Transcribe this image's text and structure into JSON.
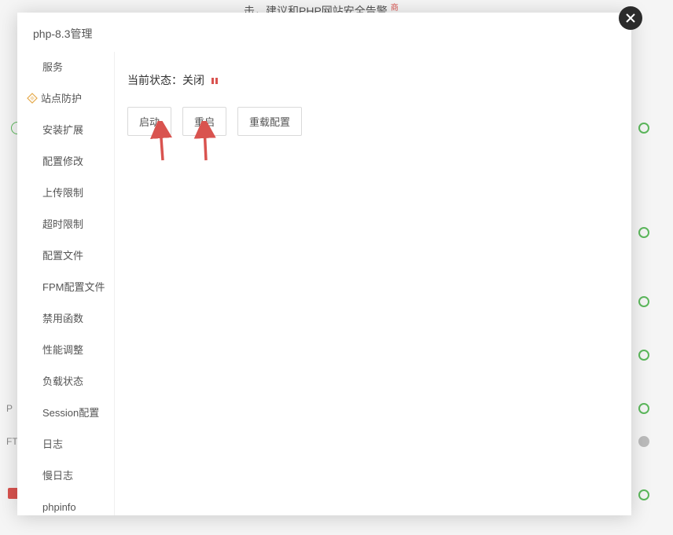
{
  "background": {
    "topText": "击，建议和PHP网站安全告警",
    "redTag": "商"
  },
  "modal": {
    "title": "php-8.3管理",
    "sidebar": {
      "items": [
        {
          "label": "服务",
          "key": "service"
        },
        {
          "label": "站点防护",
          "key": "siteprotect",
          "icon": true
        },
        {
          "label": "安装扩展",
          "key": "install-ext"
        },
        {
          "label": "配置修改",
          "key": "config-edit"
        },
        {
          "label": "上传限制",
          "key": "upload-limit"
        },
        {
          "label": "超时限制",
          "key": "timeout-limit"
        },
        {
          "label": "配置文件",
          "key": "config-file"
        },
        {
          "label": "FPM配置文件",
          "key": "fpm-config"
        },
        {
          "label": "禁用函数",
          "key": "disabled-funcs"
        },
        {
          "label": "性能调整",
          "key": "performance"
        },
        {
          "label": "负载状态",
          "key": "load-status"
        },
        {
          "label": "Session配置",
          "key": "session-config"
        },
        {
          "label": "日志",
          "key": "log"
        },
        {
          "label": "慢日志",
          "key": "slow-log"
        },
        {
          "label": "phpinfo",
          "key": "phpinfo"
        }
      ]
    },
    "content": {
      "statusPrefix": "当前状态：",
      "statusValue": "关闭",
      "buttons": {
        "start": "启动",
        "restart": "重启",
        "reload": "重载配置"
      }
    }
  },
  "leftBadges": {
    "p": "P",
    "ft": "FT"
  }
}
